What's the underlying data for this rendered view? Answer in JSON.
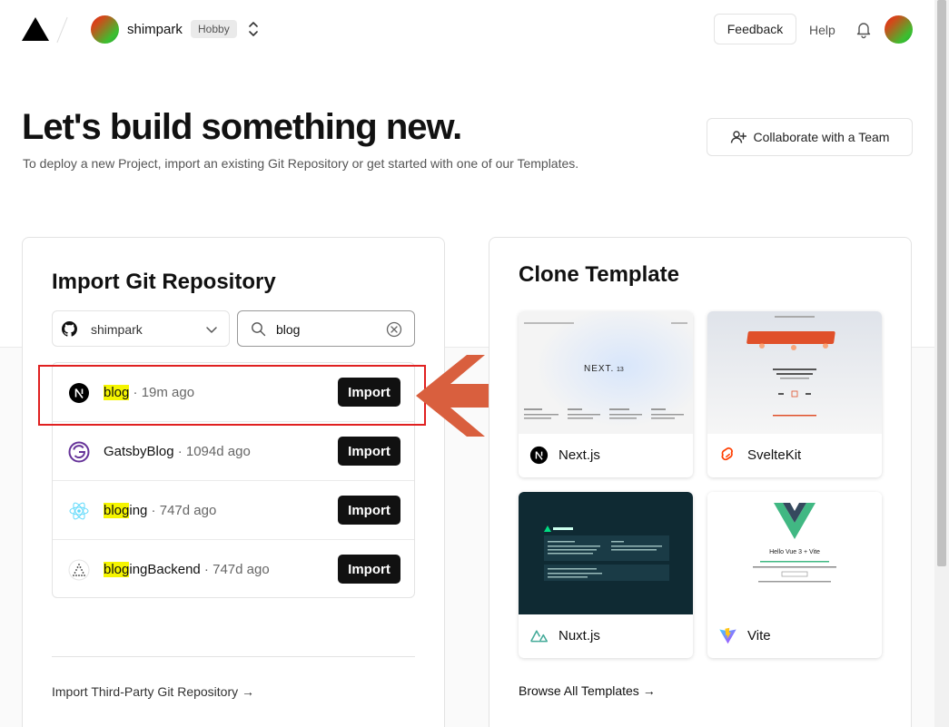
{
  "nav": {
    "team_name": "shimpark",
    "plan_badge": "Hobby",
    "feedback_label": "Feedback",
    "help_label": "Help"
  },
  "hero": {
    "title": "Let's build something new.",
    "subtitle": "To deploy a new Project, import an existing Git Repository or get started with one of our Templates.",
    "collab_label": "Collaborate with a Team"
  },
  "import": {
    "title": "Import Git Repository",
    "account": "shimpark",
    "search_value": "blog",
    "import_label": "Import",
    "repos": [
      {
        "match": "blog",
        "rest": "",
        "meta": " · 19m ago",
        "icon": "nextjs-icon"
      },
      {
        "match": "",
        "rest": "GatsbyBlog",
        "meta": " · 1094d ago",
        "icon": "gatsby-icon"
      },
      {
        "match": "blog",
        "rest": "ing",
        "meta": " · 747d ago",
        "icon": "react-icon"
      },
      {
        "match": "blog",
        "rest": "ingBackend",
        "meta": " · 747d ago",
        "icon": "triangle-dots-icon"
      }
    ],
    "third_party_label": "Import Third-Party Git Repository →"
  },
  "clone": {
    "title": "Clone Template",
    "templates": [
      {
        "name": "Next.js",
        "icon": "nextjs-icon"
      },
      {
        "name": "SvelteKit",
        "icon": "svelte-icon"
      },
      {
        "name": "Nuxt.js",
        "icon": "nuxt-icon"
      },
      {
        "name": "Vite",
        "icon": "vite-icon"
      }
    ],
    "browse_label": "Browse All Templates →"
  },
  "colors": {
    "accent_arrow": "#d95f3e",
    "highlight_border": "#e02020",
    "search_highlight": "#f5f500"
  }
}
